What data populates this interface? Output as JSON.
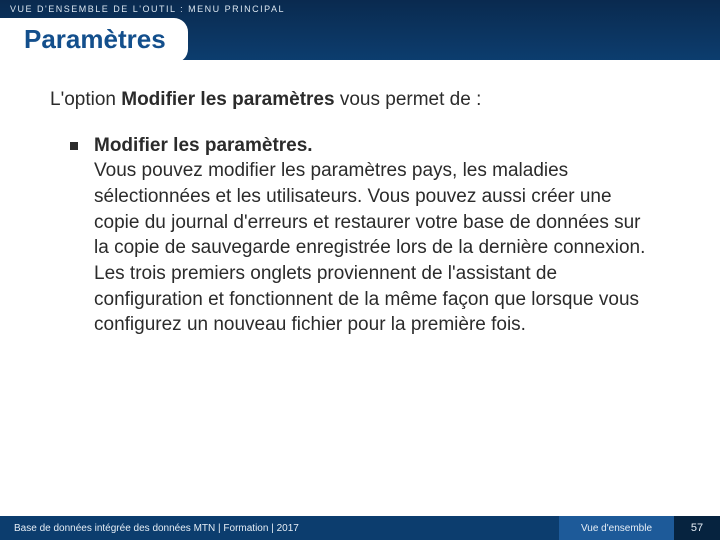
{
  "header": {
    "breadcrumb": "VUE D'ENSEMBLE DE L'OUTIL : MENU PRINCIPAL",
    "title": "Paramètres"
  },
  "body": {
    "intro_prefix": "L'option ",
    "intro_strong": "Modifier les paramètres",
    "intro_suffix": " vous permet de :",
    "bullet": {
      "strong": "Modifier les paramètres.",
      "text": "Vous pouvez modifier les paramètres pays, les maladies sélectionnées et les utilisateurs. Vous pouvez aussi créer une copie du journal d'erreurs et restaurer votre base de données sur la copie de sauvegarde enregistrée lors de la dernière connexion. Les trois premiers onglets proviennent de l'assistant de configuration et fonctionnent de la même façon que lorsque vous configurez un nouveau fichier pour la première fois."
    }
  },
  "footer": {
    "left": "Base de données intégrée des données MTN  |  Formation  |  2017",
    "section": "Vue d'ensemble",
    "page": "57"
  }
}
